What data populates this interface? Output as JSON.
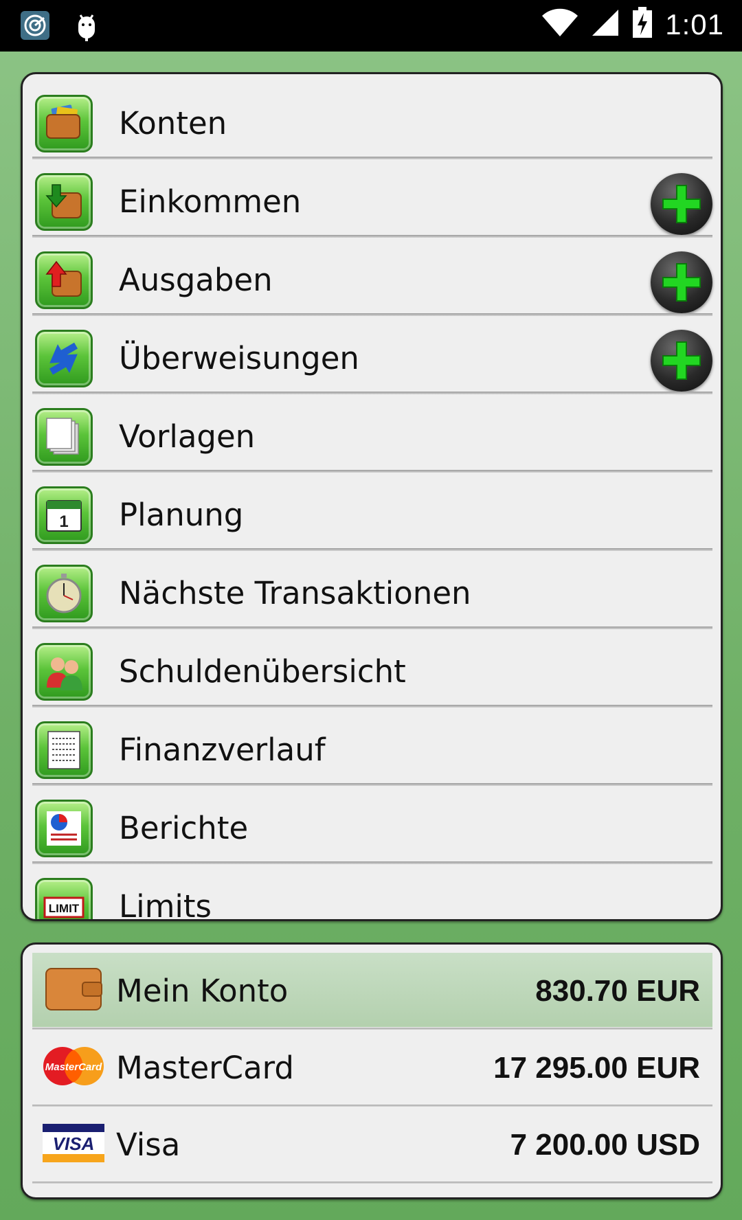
{
  "status_bar": {
    "time": "1:01",
    "icons": [
      "app-notification-icon",
      "android-debug-icon",
      "wifi-icon",
      "cell-signal-icon",
      "battery-charging-icon"
    ]
  },
  "menu": {
    "items": [
      {
        "label": "Konten",
        "icon": "wallet-cards-icon",
        "has_add": false
      },
      {
        "label": "Einkommen",
        "icon": "wallet-income-icon",
        "has_add": true
      },
      {
        "label": "Ausgaben",
        "icon": "wallet-expense-icon",
        "has_add": true
      },
      {
        "label": "Überweisungen",
        "icon": "transfer-arrows-icon",
        "has_add": true
      },
      {
        "label": "Vorlagen",
        "icon": "templates-pages-icon",
        "has_add": false
      },
      {
        "label": "Planung",
        "icon": "calendar-icon",
        "has_add": false
      },
      {
        "label": "Nächste Transaktionen",
        "icon": "stopwatch-icon",
        "has_add": false
      },
      {
        "label": "Schuldenübersicht",
        "icon": "people-icon",
        "has_add": false
      },
      {
        "label": "Finanzverlauf",
        "icon": "document-icon",
        "has_add": false
      },
      {
        "label": "Berichte",
        "icon": "pie-report-icon",
        "has_add": false
      },
      {
        "label": "Limits",
        "icon": "limit-icon",
        "icon_text": "LIMIT",
        "has_add": false
      }
    ]
  },
  "accounts": [
    {
      "name": "Mein Konto",
      "balance": "830.70 EUR",
      "icon": "wallet-icon",
      "selected": true
    },
    {
      "name": "MasterCard",
      "balance": "17 295.00 EUR",
      "icon": "mastercard-logo-icon",
      "logo_text": "MasterCard",
      "selected": false
    },
    {
      "name": "Visa",
      "balance": "7 200.00 USD",
      "icon": "visa-logo-icon",
      "logo_text": "VISA",
      "selected": false
    }
  ],
  "colors": {
    "background": "#6fb066",
    "panel": "#efefef",
    "icon_green": "#5cc43a",
    "plus_green": "#1fd21f",
    "selected_row": "#c0d9bc"
  }
}
